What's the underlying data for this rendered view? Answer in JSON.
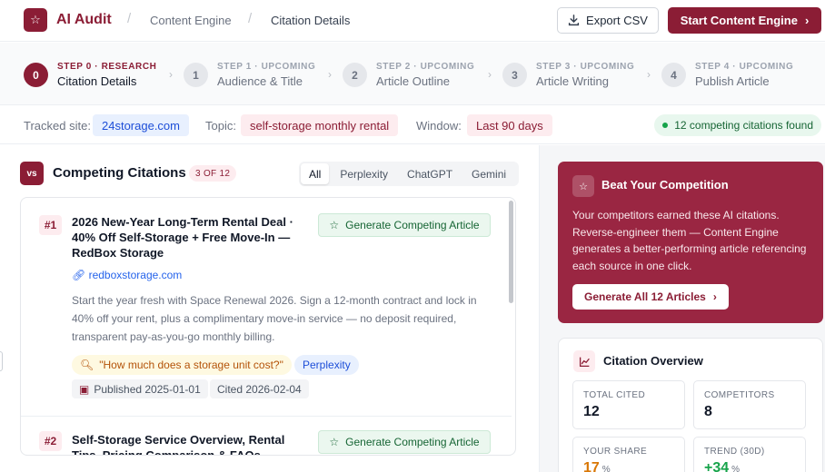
{
  "header": {
    "app_title": "AI Audit",
    "breadcrumb": [
      "Content Engine",
      "Citation Details"
    ],
    "export_label": "Export CSV",
    "start_label": "Start Content Engine"
  },
  "steps": [
    {
      "kicker": "STEP 0 · RESEARCH",
      "label": "Citation Details",
      "num": "0"
    },
    {
      "kicker": "STEP 1 · UPCOMING",
      "label": "Audience & Title",
      "num": "1"
    },
    {
      "kicker": "STEP 2 · UPCOMING",
      "label": "Article Outline",
      "num": "2"
    },
    {
      "kicker": "STEP 3 · UPCOMING",
      "label": "Article Writing",
      "num": "3"
    },
    {
      "kicker": "STEP 4 · UPCOMING",
      "label": "Publish Article",
      "num": "4"
    }
  ],
  "filters": {
    "site_label": "Tracked site:",
    "site_value": "24storage.com",
    "topic_label": "Topic:",
    "topic_value": "self-storage monthly rental",
    "window_label": "Window:",
    "window_value": "Last 90 days",
    "found_badge": "12 competing citations found"
  },
  "competing": {
    "badge": "vs",
    "title": "Competing Citations",
    "count": "3 OF 12",
    "tabs": [
      "All",
      "Perplexity",
      "ChatGPT",
      "Gemini"
    ],
    "items": [
      {
        "rank": "#1",
        "title": "2026 New-Year Long-Term Rental Deal · 40% Off Self-Storage + Free Move-In — RedBox Storage",
        "domain": "redboxstorage.com",
        "description": "Start the year fresh with Space Renewal 2026. Sign a 12-month contract and lock in 40% off your rent, plus a complimentary move-in service — no deposit required, transparent pay-as-you-go monthly billing.",
        "query": "\"How much does a storage unit cost?\"",
        "source": "Perplexity",
        "published": "Published 2025-01-01",
        "cited": "Cited 2026-02-04",
        "button": "Generate Competing Article"
      },
      {
        "rank": "#2",
        "title": "Self-Storage Service Overview, Rental Tips, Pricing Comparison & FAQs",
        "button": "Generate Competing Article"
      }
    ]
  },
  "promo": {
    "title": "Beat Your Competition",
    "text": "Your competitors earned these AI citations. Reverse-engineer them — Content Engine generates a better-performing article referencing each source in one click.",
    "button": "Generate All 12 Articles"
  },
  "overview": {
    "title": "Citation Overview",
    "stats": [
      {
        "label": "TOTAL CITED",
        "value": "12",
        "unit": ""
      },
      {
        "label": "COMPETITORS",
        "value": "8",
        "unit": ""
      },
      {
        "label": "YOUR SHARE",
        "value": "17",
        "unit": "%"
      },
      {
        "label": "TREND (30D)",
        "value": "+34",
        "unit": "%"
      }
    ]
  }
}
